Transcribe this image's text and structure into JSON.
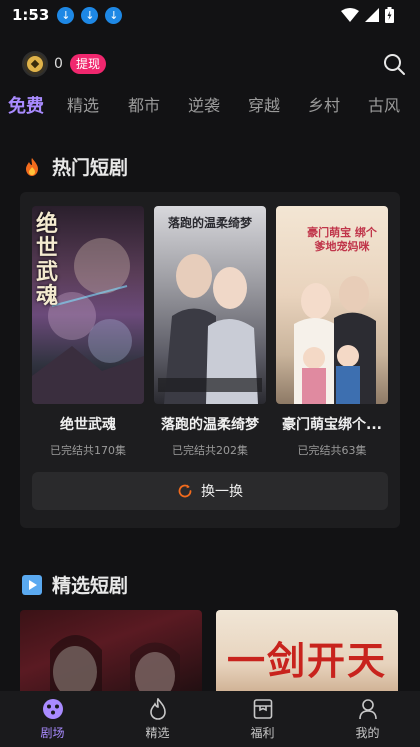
{
  "status": {
    "time": "1:53"
  },
  "topbar": {
    "coin_count": "0",
    "withdraw_label": "提现"
  },
  "tabs": [
    "免费",
    "精选",
    "都市",
    "逆袭",
    "穿越",
    "乡村",
    "古风"
  ],
  "hot_section": {
    "title": "热门短剧",
    "dramas": [
      {
        "title": "绝世武魂",
        "status": "已完结共170集",
        "poster_text": "绝世武魂"
      },
      {
        "title": "落跑的温柔绮梦",
        "status": "已完结共202集",
        "poster_text": "落跑的温柔绮梦"
      },
      {
        "title": "豪门萌宝绑个...",
        "status": "已完结共63集",
        "poster_text": "豪门萌宝 绑个爹地宠妈咪"
      }
    ],
    "refresh_label": "换一换"
  },
  "featured_section": {
    "title": "精选短剧",
    "posters": [
      "",
      "一剑开天"
    ]
  },
  "bottom_nav": [
    {
      "label": "剧场",
      "icon": "theater-icon"
    },
    {
      "label": "精选",
      "icon": "flame-icon"
    },
    {
      "label": "福利",
      "icon": "gift-box-icon"
    },
    {
      "label": "我的",
      "icon": "profile-icon"
    }
  ],
  "colors": {
    "accent": "#a98bff",
    "withdraw_badge": "#f0276e",
    "background": "#121214"
  }
}
